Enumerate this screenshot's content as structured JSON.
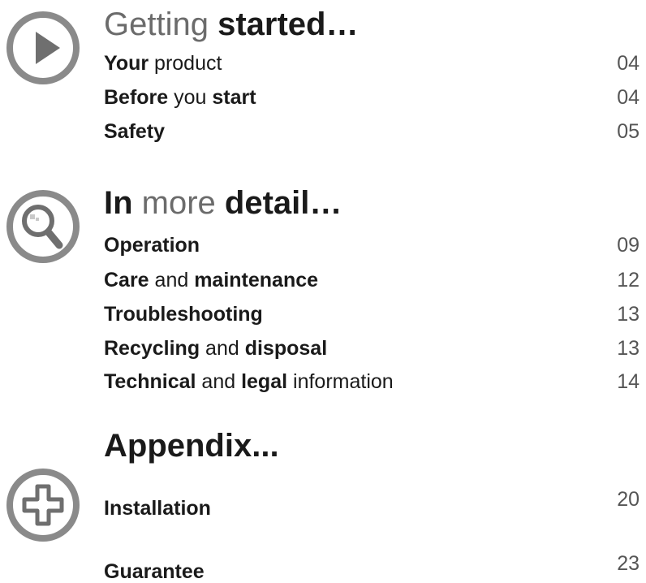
{
  "colors": {
    "icon_ring": "#8a8a8a",
    "heading_light": "#6b6b6b",
    "heading_dark": "#1a1a1a",
    "page_number": "#555555"
  },
  "sections": [
    {
      "icon": "play-icon",
      "heading": [
        {
          "text": "Getting ",
          "weight": "light"
        },
        {
          "text": "started…",
          "weight": "bold"
        }
      ],
      "entries": [
        {
          "parts": [
            {
              "text": "Your",
              "bold": true
            },
            {
              "text": " product",
              "bold": false
            }
          ],
          "page": "04"
        },
        {
          "parts": [
            {
              "text": "Before",
              "bold": true
            },
            {
              "text": " you ",
              "bold": false
            },
            {
              "text": "start",
              "bold": true
            }
          ],
          "page": "04"
        },
        {
          "parts": [
            {
              "text": "Safety",
              "bold": true
            }
          ],
          "page": "05"
        }
      ]
    },
    {
      "icon": "magnifier-icon",
      "heading": [
        {
          "text": "In",
          "weight": "bold"
        },
        {
          "text": " more ",
          "weight": "light"
        },
        {
          "text": "detail…",
          "weight": "bold"
        }
      ],
      "entries": [
        {
          "parts": [
            {
              "text": "Operation",
              "bold": true
            }
          ],
          "page": "09"
        },
        {
          "parts": [
            {
              "text": "Care",
              "bold": true
            },
            {
              "text": " and ",
              "bold": false
            },
            {
              "text": "maintenance",
              "bold": true
            }
          ],
          "page": "12"
        },
        {
          "parts": [
            {
              "text": "Troubleshooting",
              "bold": true
            }
          ],
          "page": "13"
        },
        {
          "parts": [
            {
              "text": "Recycling",
              "bold": true
            },
            {
              "text": " and ",
              "bold": false
            },
            {
              "text": "disposal",
              "bold": true
            }
          ],
          "page": "13"
        },
        {
          "parts": [
            {
              "text": "Technical",
              "bold": true
            },
            {
              "text": " and ",
              "bold": false
            },
            {
              "text": "legal",
              "bold": true
            },
            {
              "text": " information",
              "bold": false
            }
          ],
          "page": "14"
        }
      ]
    },
    {
      "icon": "plus-icon",
      "heading": [
        {
          "text": "Appendix...",
          "weight": "bold"
        }
      ],
      "entries": [
        {
          "parts": [
            {
              "text": "Installation",
              "bold": true
            }
          ],
          "page": "20"
        },
        {
          "parts": [
            {
              "text": "Guarantee",
              "bold": true
            }
          ],
          "page": "23"
        }
      ]
    }
  ]
}
